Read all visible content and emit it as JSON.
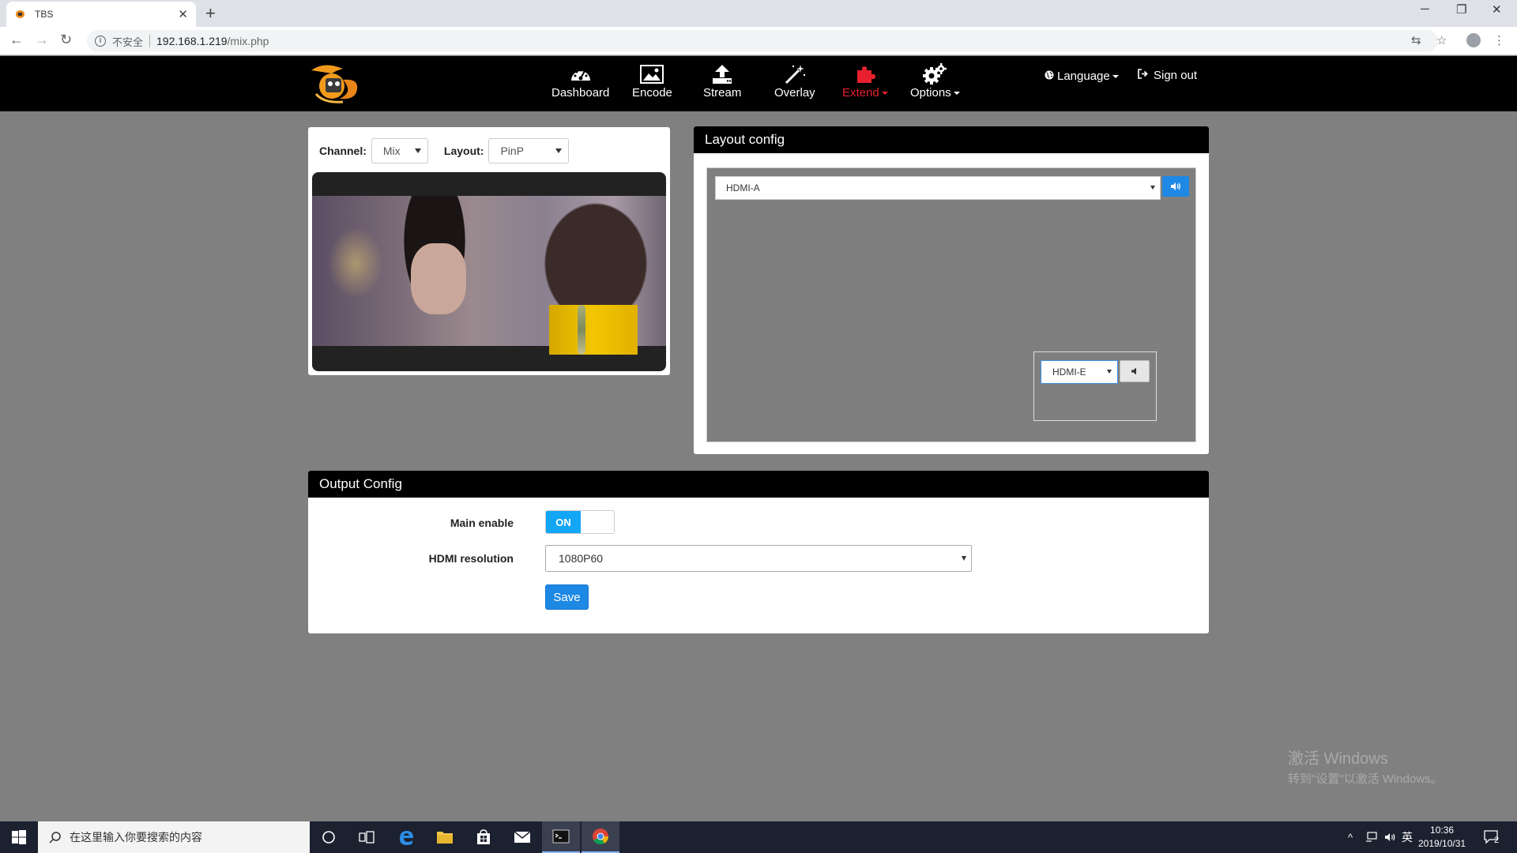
{
  "browser": {
    "tab_title": "TBS",
    "new_tab": "+",
    "close_tab": "✕",
    "insecure_label": "不安全",
    "url_host": "192.168.1.219",
    "url_path": "/mix.php"
  },
  "nav": {
    "items": [
      {
        "label": "Dashboard",
        "icon": "dashboard-icon"
      },
      {
        "label": "Encode",
        "icon": "image-icon"
      },
      {
        "label": "Stream",
        "icon": "upload-icon"
      },
      {
        "label": "Overlay",
        "icon": "magic-wand-icon"
      },
      {
        "label": "Extend",
        "icon": "puzzle-icon"
      },
      {
        "label": "Options",
        "icon": "gears-icon"
      }
    ],
    "language": "Language",
    "signout": "Sign out",
    "active_color": "#e6202e"
  },
  "preview": {
    "channel_label": "Channel:",
    "channel_value": "Mix",
    "layout_label": "Layout:",
    "layout_value": "PinP"
  },
  "layout_config": {
    "title": "Layout config",
    "main_source": "HDMI-A",
    "pip_source": "HDMI-E"
  },
  "output_config": {
    "title": "Output Config",
    "main_enable_label": "Main enable",
    "toggle_on": "ON",
    "hdmi_res_label": "HDMI resolution",
    "hdmi_res_value": "1080P60",
    "save_label": "Save",
    "accent": "#1e88e5",
    "toggle_color": "#12a6f5"
  },
  "watermark": {
    "line1": "激活 Windows",
    "line2": "转到\"设置\"以激活 Windows。"
  },
  "taskbar": {
    "search_placeholder": "在这里输入你要搜索的内容",
    "ime": "英",
    "time": "10:36",
    "date": "2019/10/31",
    "notifications": "2"
  }
}
